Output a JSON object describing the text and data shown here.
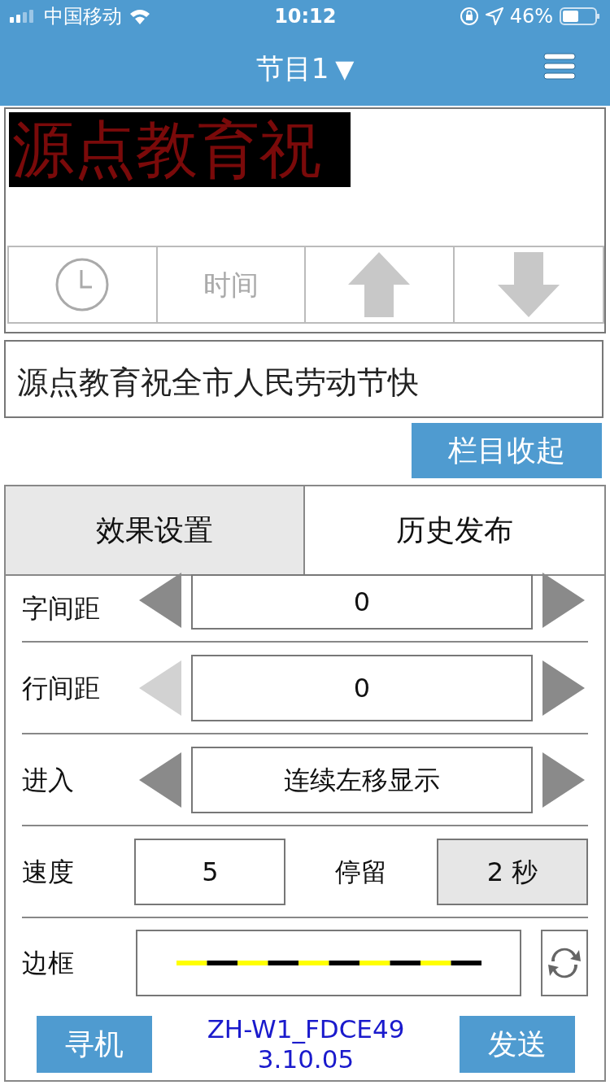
{
  "status_bar": {
    "carrier": "中国移动",
    "time": "10:12",
    "battery": "46%"
  },
  "nav": {
    "title": "节目1",
    "caret": "▼"
  },
  "preview": {
    "title": "源点教育祝",
    "tools": [
      {
        "kind": "clock"
      },
      {
        "kind": "text",
        "label": "时间"
      },
      {
        "kind": "up"
      },
      {
        "kind": "down"
      }
    ]
  },
  "message": "源点教育祝全市人民劳动节快",
  "collapse_button": "栏目收起",
  "tabs": [
    {
      "label": "效果设置",
      "selected": true
    },
    {
      "label": "历史发布",
      "selected": false
    }
  ],
  "settings": [
    {
      "kind": "stepper",
      "label": "字间距",
      "value": "0",
      "prev_disabled": false
    },
    {
      "kind": "stepper",
      "label": "行间距",
      "value": "0",
      "prev_disabled": true
    },
    {
      "kind": "stepper",
      "label": "进入",
      "value": "连续左移显示",
      "prev_disabled": false
    },
    {
      "kind": "pair",
      "label": "速度",
      "value": "5",
      "label2": "停留",
      "value2": "2 秒"
    },
    {
      "kind": "border",
      "label": "边框"
    }
  ],
  "footer": {
    "search_button": "寻机",
    "device": "ZH-W1_FDCE49",
    "version": "3.10.05",
    "send_button": "发送"
  }
}
